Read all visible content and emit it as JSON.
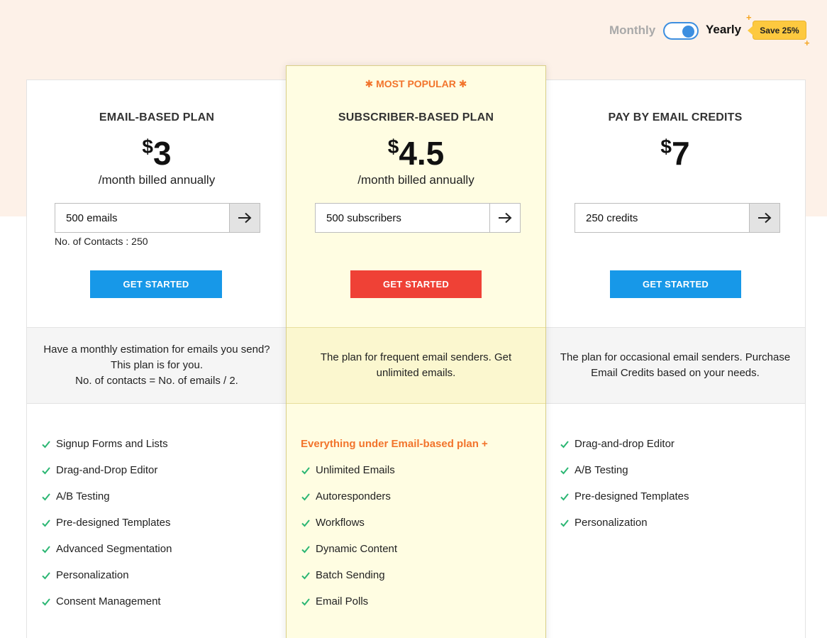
{
  "billing": {
    "monthly_label": "Monthly",
    "yearly_label": "Yearly",
    "save_badge": "Save 25%",
    "selected": "Yearly"
  },
  "plans": [
    {
      "title": "EMAIL-BASED PLAN",
      "currency": "$",
      "price": "3",
      "period": "/month billed annually",
      "quantity_value": "500 emails",
      "note": "No. of Contacts : 250",
      "cta": "GET STARTED",
      "description": [
        "Have a monthly estimation for emails you send?",
        "This plan is for you.",
        "No. of contacts = No. of emails / 2."
      ],
      "features": [
        "Signup Forms and Lists",
        "Drag-and-Drop Editor",
        "A/B Testing",
        "Pre-designed Templates",
        "Advanced Segmentation",
        "Personalization",
        "Consent Management"
      ]
    },
    {
      "badge": "MOST POPULAR",
      "title": "SUBSCRIBER-BASED PLAN",
      "currency": "$",
      "price": "4.5",
      "period": "/month billed annually",
      "quantity_value": "500 subscribers",
      "cta": "GET STARTED",
      "description": [
        "The plan for frequent email senders. Get",
        "unlimited emails."
      ],
      "features_lead": "Everything under Email-based plan +",
      "features": [
        "Unlimited Emails",
        "Autoresponders",
        "Workflows",
        "Dynamic Content",
        "Batch Sending",
        "Email Polls"
      ]
    },
    {
      "title": "PAY BY EMAIL CREDITS",
      "currency": "$",
      "price": "7",
      "quantity_value": "250 credits",
      "cta": "GET STARTED",
      "description": [
        "The plan for occasional email senders. Purchase",
        "Email Credits based on your needs."
      ],
      "features": [
        "Drag-and-drop Editor",
        "A/B Testing",
        "Pre-designed Templates",
        "Personalization"
      ]
    }
  ],
  "colors": {
    "accent_blue": "#1798e8",
    "accent_red": "#ef4136",
    "accent_orange": "#f2742c",
    "check_green": "#2bb673",
    "badge_yellow": "#fdc93f",
    "popular_bg": "#fffde2",
    "top_band": "#fdf1e8"
  },
  "icons": {
    "arrow": "arrow-right-icon",
    "check": "check-icon",
    "sparkle": "asterisk-icon"
  }
}
